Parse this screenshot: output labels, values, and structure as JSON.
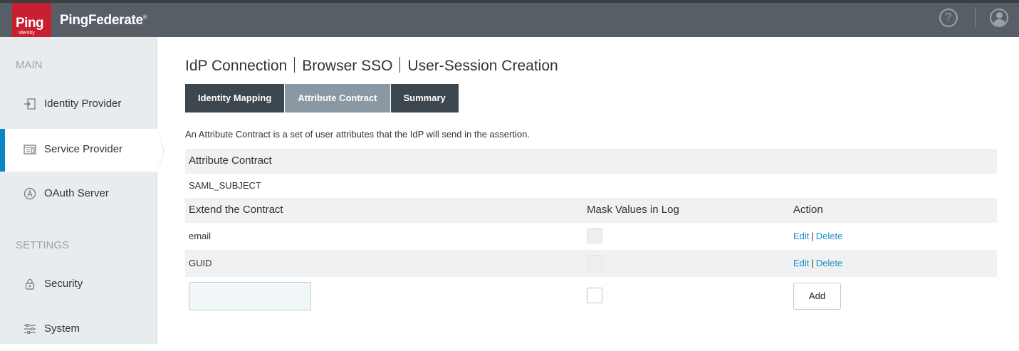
{
  "header": {
    "logo_text": "Ping",
    "logo_subtext": "Identity",
    "product_name": "PingFederate",
    "product_mark": "®",
    "help_label": "?"
  },
  "sidebar": {
    "sections": [
      {
        "label": "MAIN"
      },
      {
        "label": "SETTINGS"
      }
    ],
    "items": [
      {
        "label": "Identity Provider",
        "icon": "identity-provider-icon"
      },
      {
        "label": "Service Provider",
        "icon": "service-provider-icon",
        "active": true
      },
      {
        "label": "OAuth Server",
        "icon": "oauth-server-icon"
      },
      {
        "label": "Security",
        "icon": "lock-icon"
      },
      {
        "label": "System",
        "icon": "sliders-icon"
      }
    ]
  },
  "breadcrumb": [
    "IdP Connection",
    "Browser SSO",
    "User-Session Creation"
  ],
  "tabs": [
    {
      "label": "Identity Mapping"
    },
    {
      "label": "Attribute Contract",
      "active": true
    },
    {
      "label": "Summary"
    }
  ],
  "description": "An Attribute Contract is a set of user attributes that the IdP will send in the assertion.",
  "contract": {
    "header": "Attribute Contract",
    "core_attribute": "SAML_SUBJECT"
  },
  "extend_table": {
    "columns": [
      "Extend the Contract",
      "Mask Values in Log",
      "Action"
    ],
    "rows": [
      {
        "name": "email",
        "edit": "Edit",
        "delete": "Delete",
        "separator": "|"
      },
      {
        "name": "GUID",
        "edit": "Edit",
        "delete": "Delete",
        "separator": "|"
      }
    ],
    "new_row": {
      "value": "",
      "add_label": "Add"
    }
  },
  "colors": {
    "topbar": "#575e66",
    "brand_red": "#c8202f",
    "accent_blue": "#0b86c5",
    "tab_dark": "#3d474f",
    "tab_active": "#8a98a3",
    "link": "#1d8dc9"
  }
}
